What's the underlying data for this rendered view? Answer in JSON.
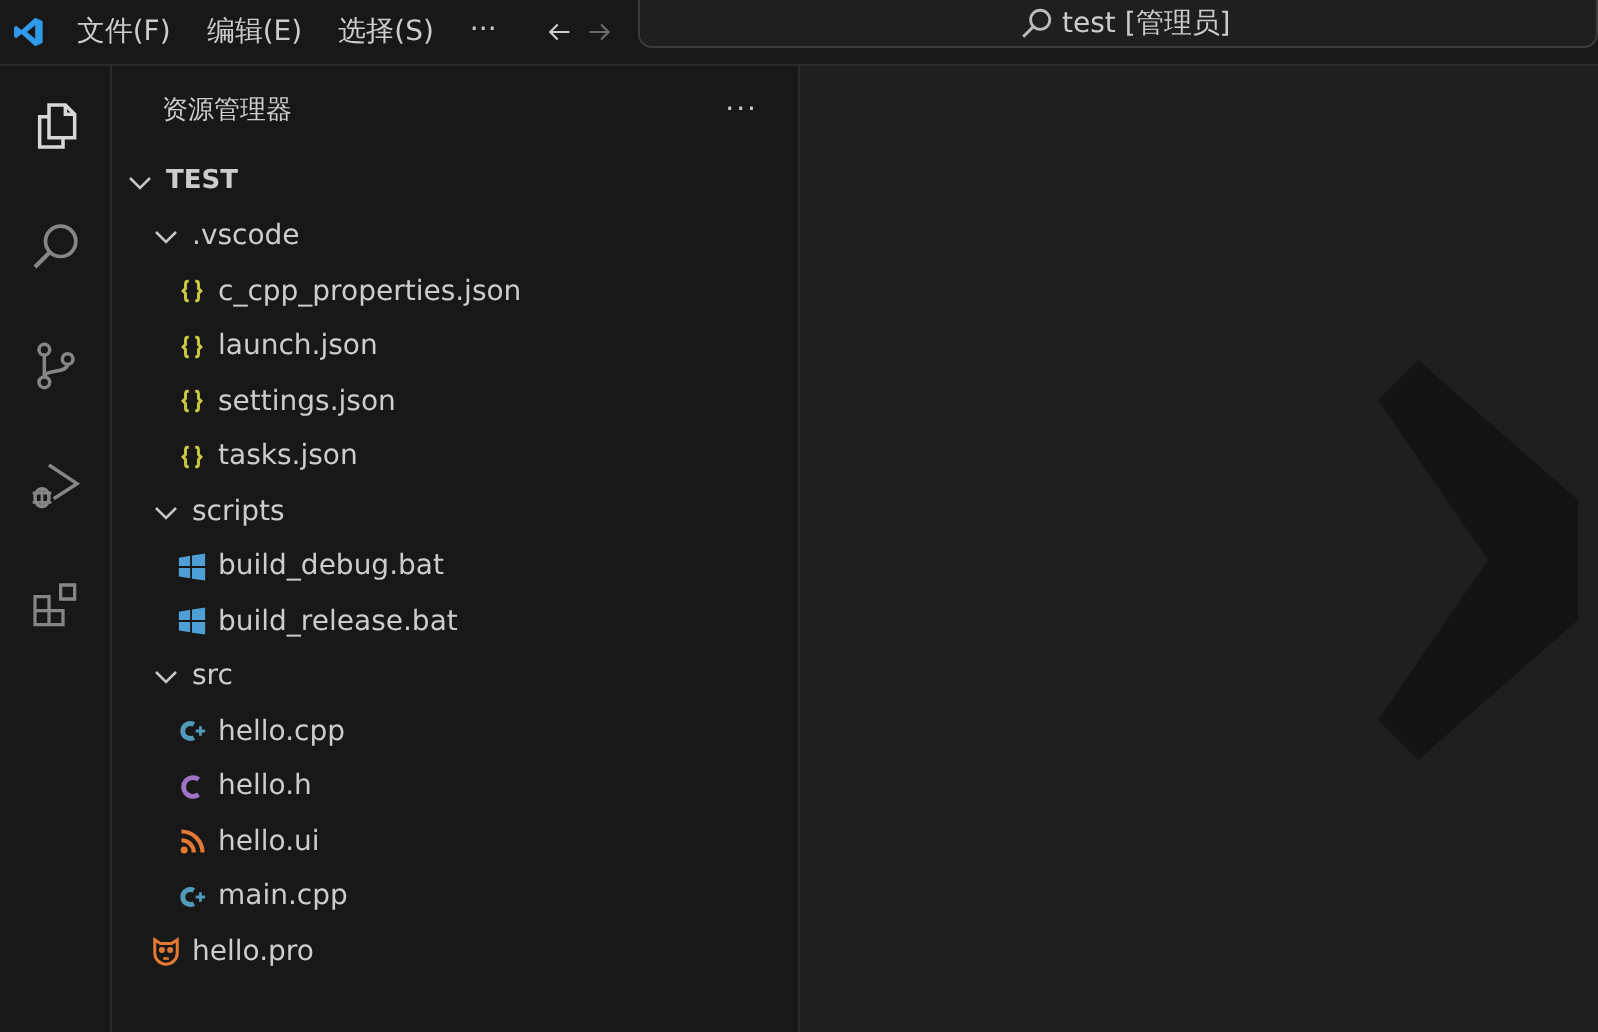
{
  "menu": [
    "文件(F)",
    "编辑(E)",
    "选择(S)",
    "···"
  ],
  "command_center": {
    "value": "test [管理员]"
  },
  "activity_bar": [
    {
      "kind": "explorer",
      "selected": true
    },
    {
      "kind": "search",
      "selected": false
    },
    {
      "kind": "source-control",
      "selected": false
    },
    {
      "kind": "run-debug",
      "selected": false
    },
    {
      "kind": "extensions",
      "selected": false
    }
  ],
  "sidebar": {
    "title": "资源管理器",
    "more": "···",
    "tree": [
      {
        "label": "TEST",
        "kind": "root",
        "expanded": true,
        "children": [
          {
            "label": ".vscode",
            "kind": "folder",
            "expanded": true,
            "children": [
              {
                "label": "c_cpp_properties.json",
                "kind": "json"
              },
              {
                "label": "launch.json",
                "kind": "json"
              },
              {
                "label": "settings.json",
                "kind": "json"
              },
              {
                "label": "tasks.json",
                "kind": "json"
              }
            ]
          },
          {
            "label": "scripts",
            "kind": "folder",
            "expanded": true,
            "children": [
              {
                "label": "build_debug.bat",
                "kind": "bat"
              },
              {
                "label": "build_release.bat",
                "kind": "bat"
              }
            ]
          },
          {
            "label": "src",
            "kind": "folder",
            "expanded": true,
            "children": [
              {
                "label": "hello.cpp",
                "kind": "cpp"
              },
              {
                "label": "hello.h",
                "kind": "h"
              },
              {
                "label": "hello.ui",
                "kind": "ui"
              },
              {
                "label": "main.cpp",
                "kind": "cpp"
              }
            ]
          },
          {
            "label": "hello.pro",
            "kind": "pro"
          }
        ]
      }
    ]
  }
}
